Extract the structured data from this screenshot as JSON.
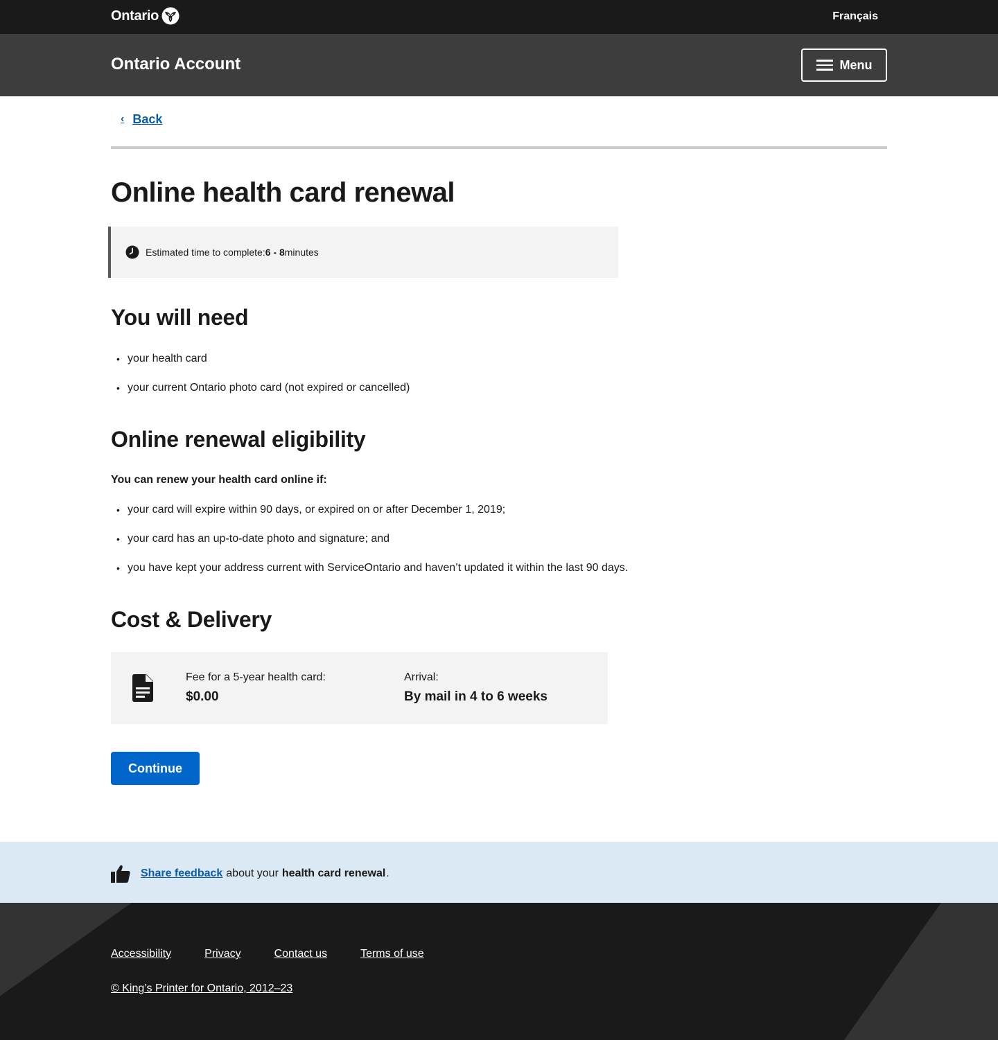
{
  "header": {
    "brand": "Ontario",
    "language_link": "Français",
    "account_title": "Ontario Account",
    "menu_label": "Menu"
  },
  "nav": {
    "back_label": "Back"
  },
  "page": {
    "title": "Online health card renewal",
    "time_notice": {
      "prefix": "Estimated time to complete: ",
      "value": "6 - 8",
      "suffix": " minutes"
    }
  },
  "need": {
    "heading": "You will need",
    "items": [
      "your health card",
      "your current Ontario photo card (not expired or cancelled)"
    ]
  },
  "eligibility": {
    "heading": "Online renewal eligibility",
    "intro": "You can renew your health card online if:",
    "items": [
      "your card will expire within 90 days, or expired on or after December 1, 2019;",
      "your card has an up-to-date photo and signature; and",
      "you have kept your address current with ServiceOntario and haven’t updated it within the last 90 days."
    ]
  },
  "cost": {
    "heading": "Cost & Delivery",
    "fee_label": "Fee for a 5-year health card:",
    "fee_value": "$0.00",
    "arrival_label": "Arrival:",
    "arrival_value": "By mail in 4 to 6 weeks"
  },
  "actions": {
    "continue_label": "Continue"
  },
  "feedback": {
    "link": "Share feedback",
    "text_mid": "about your",
    "bold": "health card renewal",
    "end": "."
  },
  "footer": {
    "links": [
      "Accessibility",
      "Privacy",
      "Contact us",
      "Terms of use"
    ],
    "copyright": "© King’s Printer for Ontario, 2012–23"
  },
  "colors": {
    "primary": "#0066cc",
    "link": "#0b5cab",
    "topbar": "#1a1a1a",
    "accountbar": "#3d3d3d",
    "feedback_bg": "#dbe9f5"
  },
  "icons": [
    "trillium-logo-icon",
    "hamburger-icon",
    "chevron-left-icon",
    "clock-icon",
    "document-icon",
    "thumbs-up-icon"
  ]
}
